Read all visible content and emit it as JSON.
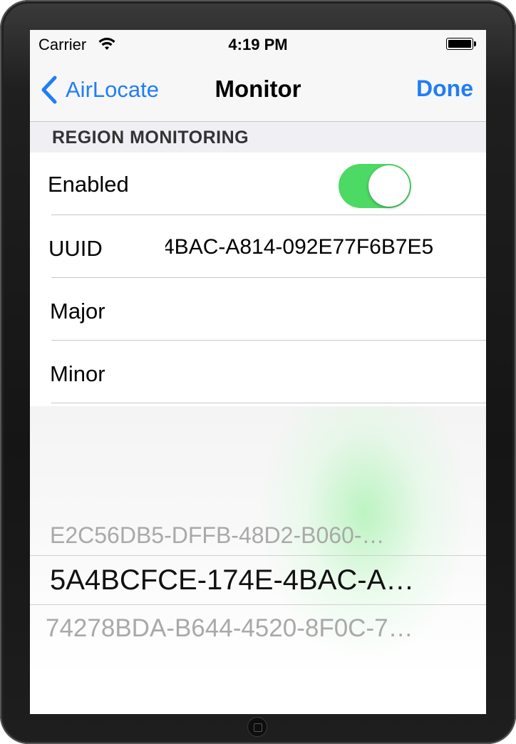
{
  "status_bar": {
    "carrier": "Carrier",
    "time": "4:19 PM",
    "wifi_icon": "wifi-icon",
    "battery_icon": "battery-icon"
  },
  "nav": {
    "back_label": "AirLocate",
    "title": "Monitor",
    "done_label": "Done",
    "accent_color": "#1f7ef6"
  },
  "section": {
    "header": "REGION MONITORING"
  },
  "cells": {
    "enabled_label": "Enabled",
    "enabled_on": true,
    "toggle_on_color": "#4cd964",
    "uuid_label": "UUID",
    "uuid_value": "4BAC-A814-092E77F6B7E5",
    "major_label": "Major",
    "minor_label": "Minor"
  },
  "picker": {
    "previous": "E2C56DB5-DFFB-48D2-B060-…",
    "selected": "5A4BCFCE-174E-4BAC-A…",
    "next": "74278BDA-B644-4520-8F0C-7…"
  }
}
